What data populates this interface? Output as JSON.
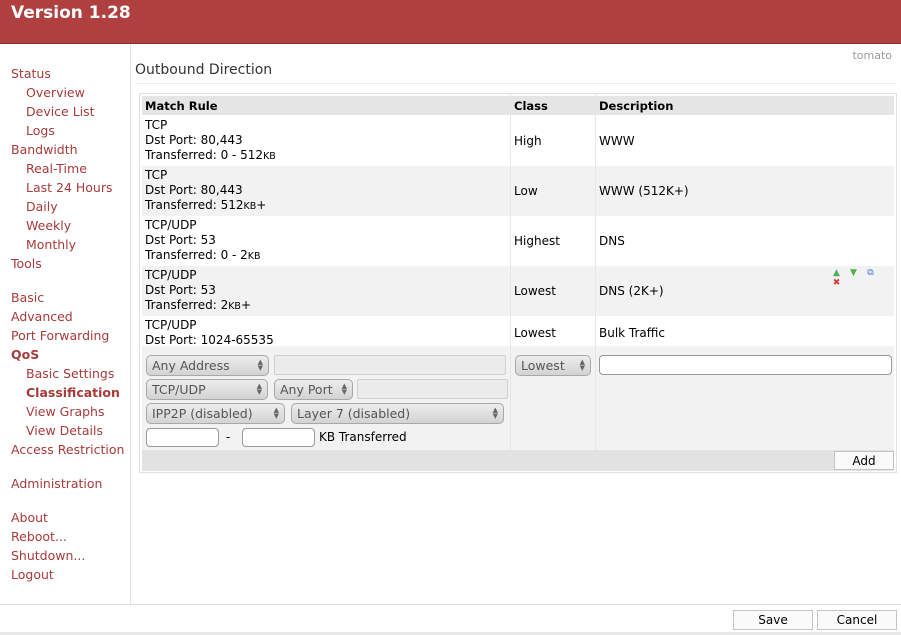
{
  "header": {
    "version": "Version 1.28"
  },
  "brand": "tomato",
  "sidebar": {
    "items": [
      {
        "label": "Status",
        "level": "top"
      },
      {
        "label": "Overview",
        "level": "sub"
      },
      {
        "label": "Device List",
        "level": "sub"
      },
      {
        "label": "Logs",
        "level": "sub"
      },
      {
        "label": "Bandwidth",
        "level": "top"
      },
      {
        "label": "Real-Time",
        "level": "sub"
      },
      {
        "label": "Last 24 Hours",
        "level": "sub"
      },
      {
        "label": "Daily",
        "level": "sub"
      },
      {
        "label": "Weekly",
        "level": "sub"
      },
      {
        "label": "Monthly",
        "level": "sub"
      },
      {
        "label": "Tools",
        "level": "top"
      },
      {
        "label": "Basic",
        "level": "top"
      },
      {
        "label": "Advanced",
        "level": "top"
      },
      {
        "label": "Port Forwarding",
        "level": "top"
      },
      {
        "label": "QoS",
        "level": "top",
        "active": true
      },
      {
        "label": "Basic Settings",
        "level": "sub"
      },
      {
        "label": "Classification",
        "level": "sub",
        "active": true
      },
      {
        "label": "View Graphs",
        "level": "sub"
      },
      {
        "label": "View Details",
        "level": "sub"
      },
      {
        "label": "Access Restriction",
        "level": "top"
      },
      {
        "label": "Administration",
        "level": "top"
      },
      {
        "label": "About",
        "level": "top"
      },
      {
        "label": "Reboot...",
        "level": "top"
      },
      {
        "label": "Shutdown...",
        "level": "top"
      },
      {
        "label": "Logout",
        "level": "top"
      }
    ]
  },
  "section": {
    "title": "Outbound Direction"
  },
  "table": {
    "headers": {
      "rule": "Match Rule",
      "class": "Class",
      "description": "Description"
    },
    "rows": [
      {
        "proto": "TCP",
        "port": "Dst Port: 80,443",
        "xfer_prefix": "Transferred: 0 - 512",
        "xfer_unit": "KB",
        "xfer_suffix": "",
        "class": "High",
        "description": "WWW"
      },
      {
        "proto": "TCP",
        "port": "Dst Port: 80,443",
        "xfer_prefix": "Transferred: 512",
        "xfer_unit": "KB",
        "xfer_suffix": "+",
        "class": "Low",
        "description": "WWW (512K+)"
      },
      {
        "proto": "TCP/UDP",
        "port": "Dst Port: 53",
        "xfer_prefix": "Transferred: 0 - 2",
        "xfer_unit": "KB",
        "xfer_suffix": "",
        "class": "Highest",
        "description": "DNS"
      },
      {
        "proto": "TCP/UDP",
        "port": "Dst Port: 53",
        "xfer_prefix": "Transferred: 2",
        "xfer_unit": "KB",
        "xfer_suffix": "+",
        "class": "Lowest",
        "description": "DNS (2K+)"
      },
      {
        "proto": "TCP/UDP",
        "port": "Dst Port: 1024-65535",
        "class": "Lowest",
        "description": "Bulk Traffic"
      }
    ],
    "row_icons": {
      "up": "▲",
      "down": "▼",
      "copy": "⧉",
      "delete": "✖"
    }
  },
  "editor": {
    "address_select": "Any Address",
    "protocol_select": "TCP/UDP",
    "port_select": "Any Port",
    "ipp2p_select": "IPP2P (disabled)",
    "layer7_select": "Layer 7 (disabled)",
    "range_dash": "-",
    "kb_transferred": "KB Transferred",
    "class_select": "Lowest",
    "description_value": "",
    "add_button": "Add"
  },
  "footer": {
    "save_button": "Save",
    "cancel_button": "Cancel"
  },
  "colors": {
    "header": "#b04040",
    "nav_link": "#a83a3a",
    "row_alt": "#f2f2f2",
    "icon_green": "#4caf50",
    "icon_blue": "#3d7bd6",
    "icon_red": "#d33"
  }
}
